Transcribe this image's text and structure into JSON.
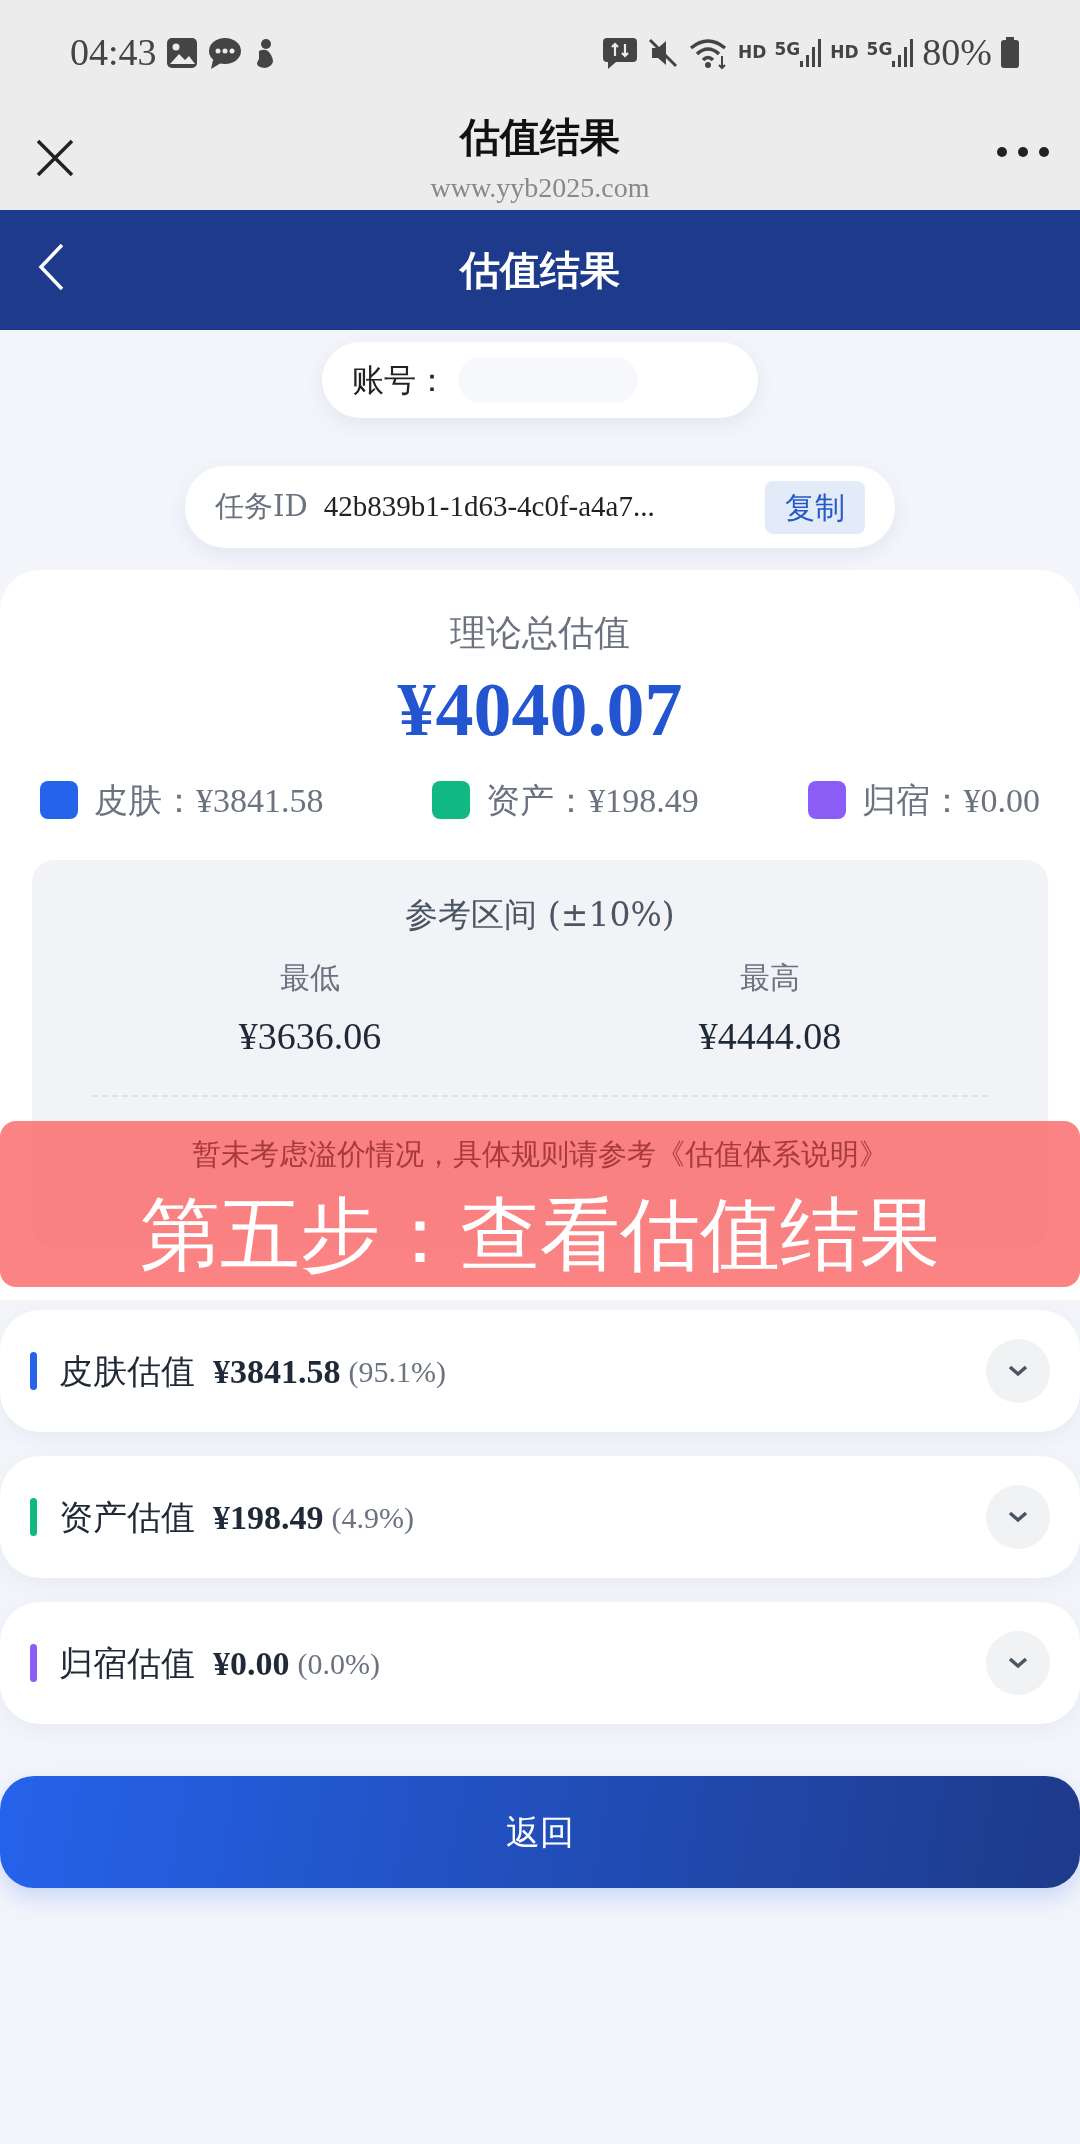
{
  "status_bar": {
    "time": "04:43",
    "signals": [
      {
        "hd": "HD",
        "net": "5G"
      },
      {
        "hd": "HD",
        "net": "5G"
      }
    ],
    "battery": "80%"
  },
  "browser": {
    "title": "估值结果",
    "url": "www.yyb2025.com"
  },
  "header": {
    "title": "估值结果"
  },
  "account": {
    "label": "账号："
  },
  "task": {
    "label": "任务ID",
    "id": "42b839b1-1d63-4c0f-a4a7...",
    "copy": "复制"
  },
  "total": {
    "title": "理论总估值",
    "amount": "¥4040.07"
  },
  "legend": [
    {
      "label": "皮肤：¥3841.58",
      "color": "#2563eb"
    },
    {
      "label": "资产：¥198.49",
      "color": "#10b981"
    },
    {
      "label": "归宿：¥0.00",
      "color": "#8b5cf6"
    }
  ],
  "range": {
    "title": "参考区间 (±10%)",
    "low_label": "最低",
    "low": "¥3636.06",
    "high_label": "最高",
    "high": "¥4444.08",
    "note": "暂未考虑溢价情况，具体规则请参考《估值体系说明》"
  },
  "overlay": {
    "text": "第五步：查看估值结果"
  },
  "sections": [
    {
      "name": "皮肤估值",
      "amount": "¥3841.58",
      "percent": "(95.1%)",
      "color": "#2563eb"
    },
    {
      "name": "资产估值",
      "amount": "¥198.49",
      "percent": "(4.9%)",
      "color": "#10b981"
    },
    {
      "name": "归宿估值",
      "amount": "¥0.00",
      "percent": "(0.0%)",
      "color": "#8b5cf6"
    }
  ],
  "button": "返回"
}
